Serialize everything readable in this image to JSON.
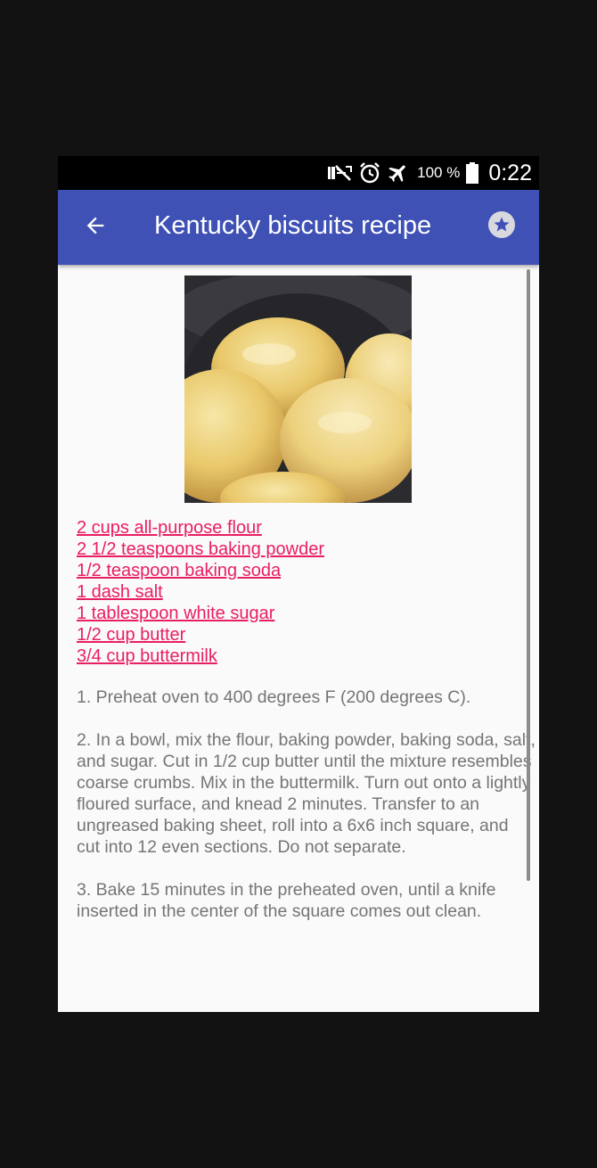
{
  "status_bar": {
    "icons": [
      "mute-icon",
      "alarm-icon",
      "airplane-icon",
      "battery-icon"
    ],
    "battery_percent": "100 %",
    "time": "0:22"
  },
  "app_bar": {
    "title": "Kentucky biscuits recipe",
    "back_icon": "arrow-left-icon",
    "favorite_icon": "star-icon",
    "color": "#3f51b5"
  },
  "recipe": {
    "image": "biscuits-photo",
    "ingredients": [
      "2 cups all-purpose flour",
      "2 1/2 teaspoons baking powder",
      "1/2 teaspoon baking soda",
      "1 dash salt",
      "1 tablespoon white sugar",
      "1/2 cup butter",
      "3/4 cup buttermilk"
    ],
    "ingredient_color": "#e91e63",
    "directions": [
      "1. Preheat oven to 400 degrees F (200 degrees C).",
      "2. In a bowl, mix the flour, baking powder, baking soda, salt, and sugar. Cut in 1/2 cup butter until the mixture resembles coarse crumbs. Mix in the buttermilk. Turn out onto a lightly floured surface, and knead 2 minutes. Transfer to an ungreased baking sheet, roll into a 6x6 inch square, and cut into 12 even sections. Do not separate.",
      "3. Bake 15 minutes in the preheated oven, until a knife inserted in the center of the square comes out clean."
    ]
  }
}
